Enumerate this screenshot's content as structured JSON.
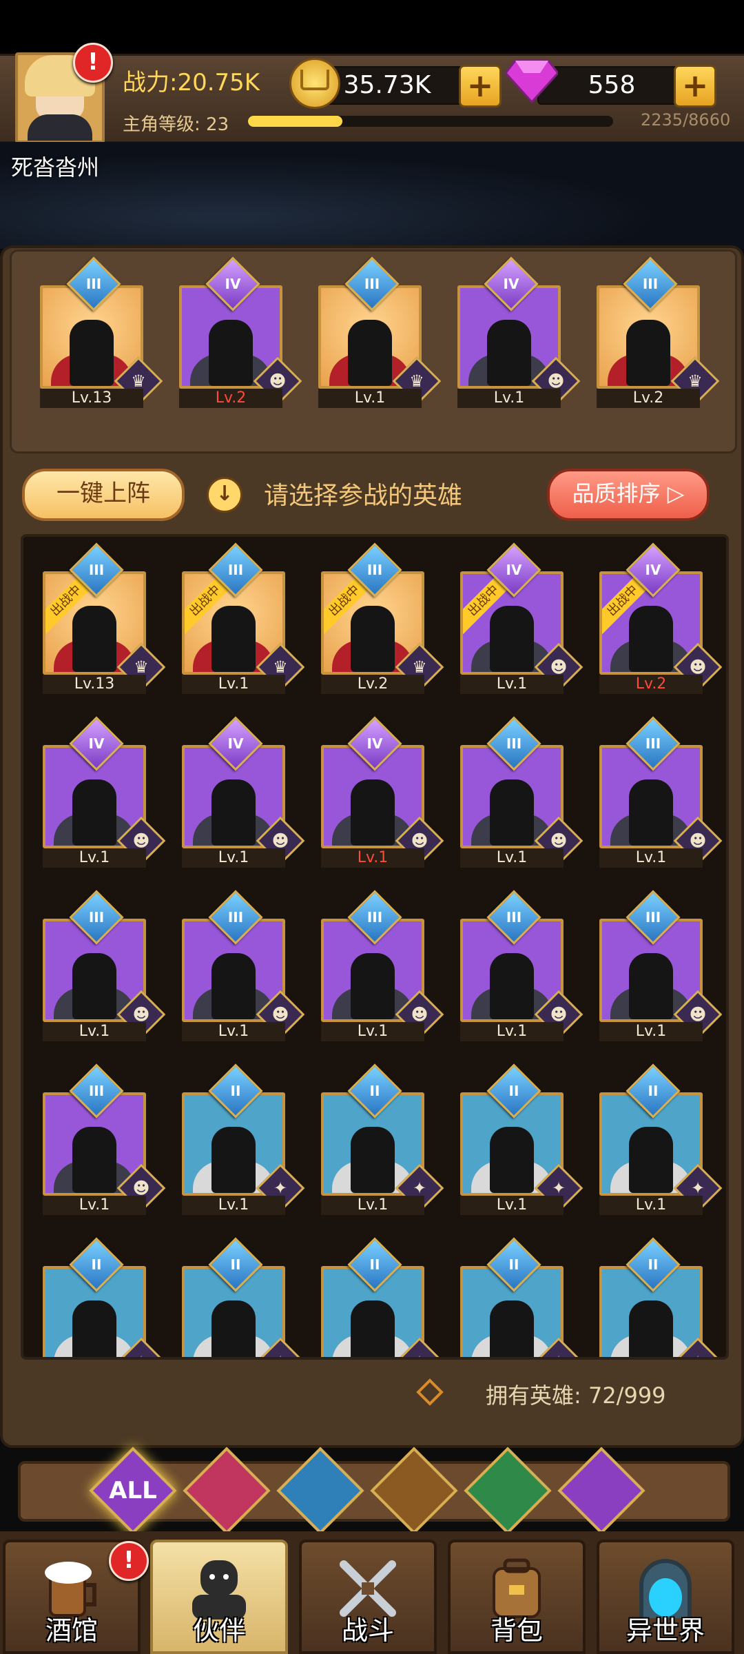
{
  "header": {
    "power": "战力:20.75K",
    "level_label": "主角等级: 23",
    "xp_text": "2235/8660",
    "xp_fraction": 0.258,
    "gold": "35.73K",
    "gems": "558",
    "plus": "+",
    "alert": "!"
  },
  "location": "死沓沓州",
  "team": [
    {
      "level": "Lv.13",
      "tier": "III",
      "quality": "q3",
      "level_red": false
    },
    {
      "level": "Lv.2",
      "tier": "IV",
      "quality": "q4",
      "level_red": true
    },
    {
      "level": "Lv.1",
      "tier": "III",
      "quality": "q3",
      "level_red": false
    },
    {
      "level": "Lv.1",
      "tier": "IV",
      "quality": "q4",
      "level_red": false
    },
    {
      "level": "Lv.2",
      "tier": "III",
      "quality": "q3",
      "level_red": false
    }
  ],
  "controls": {
    "auto_deploy": "一键上阵",
    "prompt": "请选择参战的英雄",
    "sort": "品质排序 ▷",
    "info_icon": "↓"
  },
  "deployed_ribbon": "出战中",
  "roster": [
    {
      "level": "Lv.13",
      "tier": "III",
      "quality": "q3",
      "deployed": true,
      "red": false
    },
    {
      "level": "Lv.1",
      "tier": "III",
      "quality": "q3",
      "deployed": true,
      "red": false
    },
    {
      "level": "Lv.2",
      "tier": "III",
      "quality": "q3",
      "deployed": true,
      "red": false
    },
    {
      "level": "Lv.1",
      "tier": "IV",
      "quality": "q4",
      "deployed": true,
      "red": false
    },
    {
      "level": "Lv.2",
      "tier": "IV",
      "quality": "q4",
      "deployed": true,
      "red": true
    },
    {
      "level": "Lv.1",
      "tier": "IV",
      "quality": "q4",
      "deployed": false,
      "red": false
    },
    {
      "level": "Lv.1",
      "tier": "IV",
      "quality": "q4",
      "deployed": false,
      "red": false
    },
    {
      "level": "Lv.1",
      "tier": "IV",
      "quality": "q4",
      "deployed": false,
      "red": true
    },
    {
      "level": "Lv.1",
      "tier": "III",
      "quality": "q4",
      "deployed": false,
      "red": false
    },
    {
      "level": "Lv.1",
      "tier": "III",
      "quality": "q4",
      "deployed": false,
      "red": false
    },
    {
      "level": "Lv.1",
      "tier": "III",
      "quality": "q4",
      "deployed": false,
      "red": false
    },
    {
      "level": "Lv.1",
      "tier": "III",
      "quality": "q4",
      "deployed": false,
      "red": false
    },
    {
      "level": "Lv.1",
      "tier": "III",
      "quality": "q4",
      "deployed": false,
      "red": false
    },
    {
      "level": "Lv.1",
      "tier": "III",
      "quality": "q4",
      "deployed": false,
      "red": false
    },
    {
      "level": "Lv.1",
      "tier": "III",
      "quality": "q4",
      "deployed": false,
      "red": false
    },
    {
      "level": "Lv.1",
      "tier": "III",
      "quality": "q4",
      "deployed": false,
      "red": false
    },
    {
      "level": "Lv.1",
      "tier": "II",
      "quality": "q2",
      "deployed": false,
      "red": false
    },
    {
      "level": "Lv.1",
      "tier": "II",
      "quality": "q2",
      "deployed": false,
      "red": false
    },
    {
      "level": "Lv.1",
      "tier": "II",
      "quality": "q2",
      "deployed": false,
      "red": false
    },
    {
      "level": "Lv.1",
      "tier": "II",
      "quality": "q2",
      "deployed": false,
      "red": false
    },
    {
      "level": "",
      "tier": "II",
      "quality": "q2",
      "deployed": false,
      "red": false
    },
    {
      "level": "",
      "tier": "II",
      "quality": "q2",
      "deployed": false,
      "red": false
    },
    {
      "level": "",
      "tier": "II",
      "quality": "q2",
      "deployed": false,
      "red": false
    },
    {
      "level": "",
      "tier": "II",
      "quality": "q2",
      "deployed": false,
      "red": false
    },
    {
      "level": "",
      "tier": "II",
      "quality": "q2",
      "deployed": false,
      "red": false
    }
  ],
  "owned_heroes": "拥有英雄: 72/999",
  "filters": [
    {
      "label": "ALL",
      "icon": "all-filter-icon",
      "color": "#8a3fc0"
    },
    {
      "label": "",
      "icon": "crown-faction-icon",
      "color": "#c0365e"
    },
    {
      "label": "",
      "icon": "fish-faction-icon",
      "color": "#2f7fb8"
    },
    {
      "label": "",
      "icon": "lion-faction-icon",
      "color": "#8a5a22"
    },
    {
      "label": "",
      "icon": "elf-faction-icon",
      "color": "#2f8a4a"
    },
    {
      "label": "",
      "icon": "demon-faction-icon",
      "color": "#8a3fc0"
    }
  ],
  "nav": [
    {
      "label": "酒馆",
      "icon": "beer-mug-icon",
      "active": false,
      "alert": true
    },
    {
      "label": "伙伴",
      "icon": "partner-icon",
      "active": true,
      "alert": false
    },
    {
      "label": "战斗",
      "icon": "crossed-swords-icon",
      "active": false,
      "alert": false
    },
    {
      "label": "背包",
      "icon": "backpack-icon",
      "active": false,
      "alert": false
    },
    {
      "label": "异世界",
      "icon": "portal-icon",
      "active": false,
      "alert": false
    }
  ]
}
